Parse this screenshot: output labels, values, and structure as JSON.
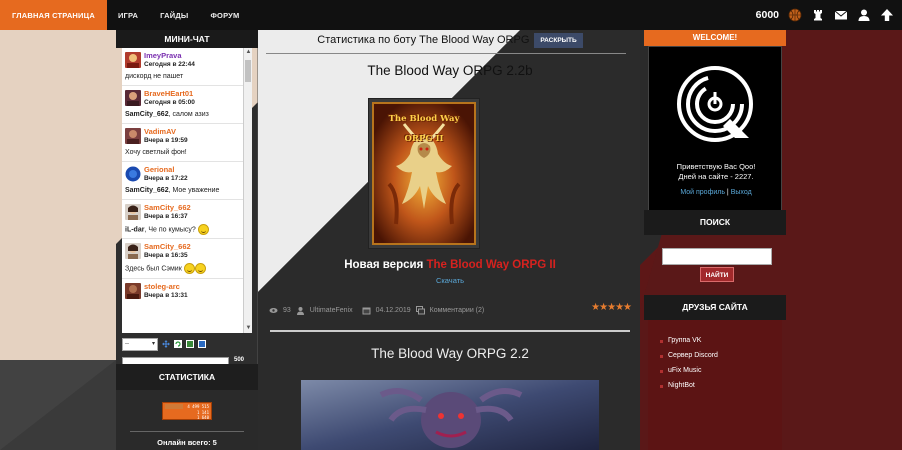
{
  "nav": {
    "items": [
      {
        "label": "ГЛАВНАЯ СТРАНИЦА",
        "active": true
      },
      {
        "label": "ИГРА",
        "active": false
      },
      {
        "label": "ГАЙДЫ",
        "active": false
      },
      {
        "label": "ФОРУМ",
        "active": false
      }
    ],
    "coins": "6000",
    "icons": [
      "basketball-icon",
      "chess-rook-icon",
      "mail-icon",
      "user-icon",
      "arrow-up-icon"
    ]
  },
  "chat": {
    "header": "МИНИ-ЧАТ",
    "messages": [
      {
        "name": "ImeyPrava",
        "name_color": "#7a2fb0",
        "time": "Сегодня в 22:44",
        "text": "дискорд не пашет"
      },
      {
        "name": "BraveHEart01",
        "name_color": "#e66a1f",
        "time": "Сегодня в 05:00",
        "text_bold": "SamCity_662",
        "text": ", салом азиз"
      },
      {
        "name": "VadimAV",
        "name_color": "#e66a1f",
        "time": "Вчера в 19:59",
        "text": "Хочу светлый фон!"
      },
      {
        "name": "Gerional",
        "name_color": "#e66a1f",
        "time": "Вчера в 17:22",
        "text_bold": "SamCity_662",
        "text": ", Мое уважение"
      },
      {
        "name": "SamCity_662",
        "name_color": "#e66a1f",
        "time": "Вчера в 16:37",
        "text_bold": "iL-dar",
        "text": ", Че по кумысу?"
      },
      {
        "name": "SamCity_662",
        "name_color": "#e66a1f",
        "time": "Вчера в 16:35",
        "text": "Здесь был Сэмик"
      },
      {
        "name": "stoleg-arc",
        "name_color": "#e66a1f",
        "time": "Вчера в 13:31",
        "text": ""
      }
    ],
    "select_value": "--",
    "char_count": "500",
    "ok_label": "OK"
  },
  "stats": {
    "header": "СТАТИСТИКА",
    "counter": [
      "4 499 515",
      "1 141",
      "1 640"
    ],
    "online": "Онлайн всего: 5"
  },
  "center": {
    "stat_title": "Статистика по боту The Blood Way ORPG",
    "expand_label": "РАСКРЫТЬ",
    "post1": {
      "title": "The Blood Way ORPG 2.2b",
      "banner": "The Blood Way ORPG II",
      "headline_white": "Новая версия ",
      "headline_red": "The Blood Way ORPG II",
      "download": "Скачать",
      "views": "93",
      "author": "UltimateFenix",
      "date": "04.12.2019",
      "comments": "Комментарии (2)",
      "rating_stars": 5
    },
    "post2": {
      "title": "The Blood Way ORPG 2.2"
    }
  },
  "right": {
    "welcome_header": "WELCOME!",
    "greet_line1": "Приветствую Вас Qoo!",
    "greet_line2": "Дней на сайте - 2227.",
    "profile_link": "Мой профиль",
    "link_sep": " | ",
    "logout_link": "Выход",
    "search_header": "ПОИСК",
    "search_button": "НАЙТИ",
    "friends_header": "ДРУЗЬЯ САЙТА",
    "friends": [
      "Группа VK",
      "Сервер Discord",
      "uFix Music",
      "NightBot"
    ]
  },
  "colors": {
    "accent": "#e66a1f",
    "dark": "#111111",
    "red": "#d6221f",
    "link": "#5aa8d8"
  }
}
